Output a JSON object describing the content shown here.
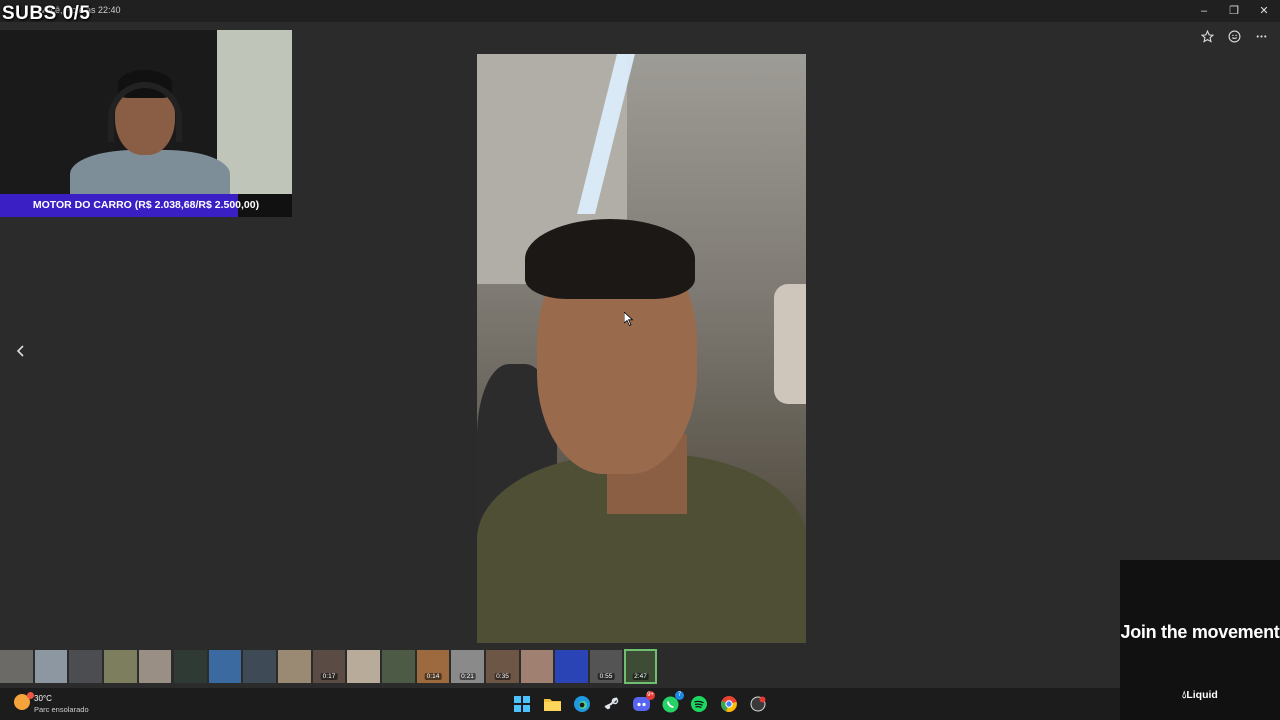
{
  "window": {
    "title": "Você, Hoje às 22:40"
  },
  "overlay": {
    "subs_counter": "SUBS   0/5",
    "goal_text": "MOTOR DO CARRO (R$ 2.038,68/R$ 2.500,00)",
    "goal_progress": 0.8155
  },
  "filmstrip": {
    "durations": [
      "0:17",
      "0:14",
      "0:21",
      "0:35",
      "0:55",
      "2:47"
    ],
    "selected_label": "2:47"
  },
  "taskbar": {
    "weather_temp": "30°C",
    "weather_condition": "Parc ensolarado",
    "discord_badge": "9+",
    "whatsapp_badge": "7"
  },
  "ad": {
    "headline": "Join the movement",
    "brand": "Liquid"
  },
  "colors": {
    "background": "#2b2b2b",
    "goal_fill": "#3a1fc4",
    "selected_thumb_outline": "#6fbf73"
  }
}
